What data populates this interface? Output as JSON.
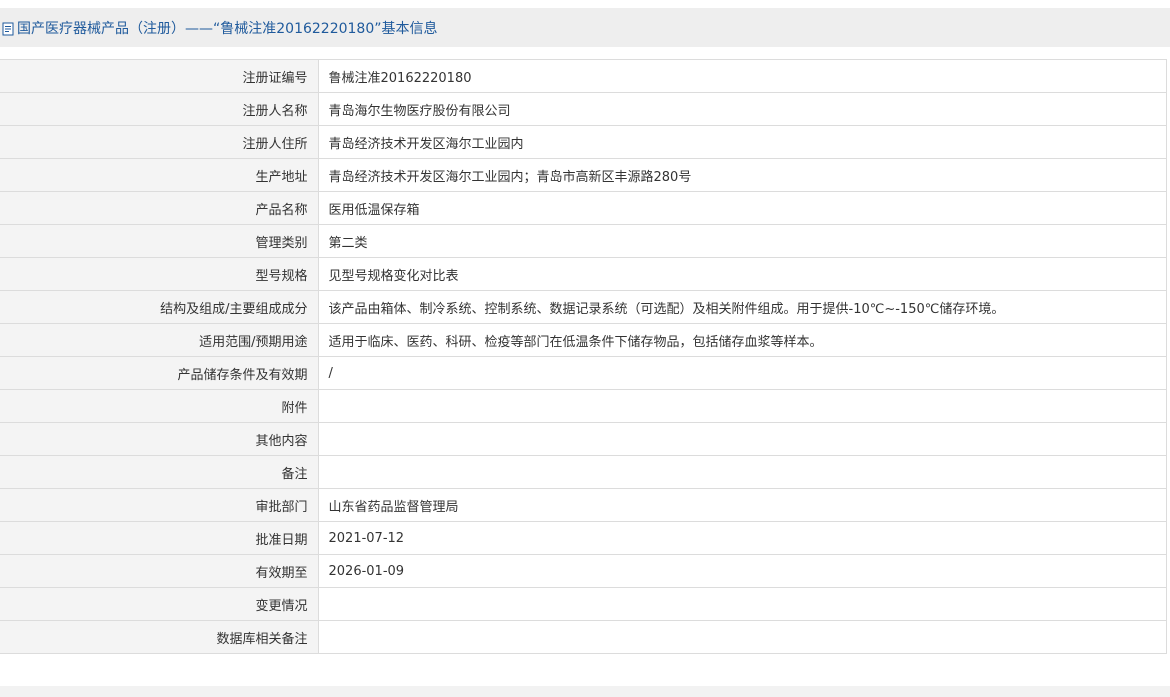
{
  "header": {
    "icon": "document-icon",
    "title": "国产医疗器械产品（注册）——“鲁械注准20162220180”基本信息"
  },
  "rows": [
    {
      "label": "注册证编号",
      "value": "鲁械注准20162220180"
    },
    {
      "label": "注册人名称",
      "value": "青岛海尔生物医疗股份有限公司"
    },
    {
      "label": "注册人住所",
      "value": "青岛经济技术开发区海尔工业园内"
    },
    {
      "label": "生产地址",
      "value": "青岛经济技术开发区海尔工业园内；青岛市高新区丰源路280号"
    },
    {
      "label": "产品名称",
      "value": "医用低温保存箱"
    },
    {
      "label": "管理类别",
      "value": "第二类"
    },
    {
      "label": "型号规格",
      "value": "见型号规格变化对比表"
    },
    {
      "label": "结构及组成/主要组成成分",
      "value": "该产品由箱体、制冷系统、控制系统、数据记录系统（可选配）及相关附件组成。用于提供-10℃~-150℃储存环境。"
    },
    {
      "label": "适用范围/预期用途",
      "value": "适用于临床、医药、科研、检疫等部门在低温条件下储存物品，包括储存血浆等样本。"
    },
    {
      "label": "产品储存条件及有效期",
      "value": "/"
    },
    {
      "label": "附件",
      "value": ""
    },
    {
      "label": "其他内容",
      "value": ""
    },
    {
      "label": "备注",
      "value": ""
    },
    {
      "label": "审批部门",
      "value": "山东省药品监督管理局"
    },
    {
      "label": "批准日期",
      "value": "2021-07-12"
    },
    {
      "label": "有效期至",
      "value": "2026-01-09"
    },
    {
      "label": "变更情况",
      "value": ""
    },
    {
      "label": "数据库相关备注",
      "value": ""
    }
  ]
}
